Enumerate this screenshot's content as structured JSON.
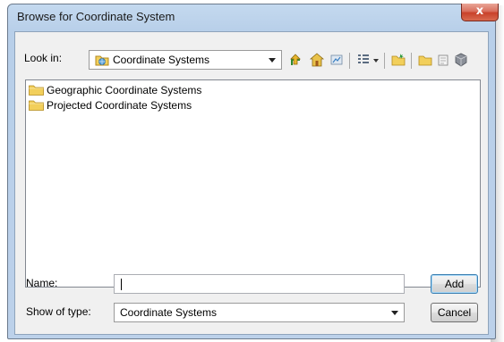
{
  "window": {
    "title": "Browse for Coordinate System",
    "close_label": "x"
  },
  "look_in": {
    "label": "Look in:",
    "value": "Coordinate Systems"
  },
  "toolbar": {
    "icons": [
      "up-one-level-icon",
      "home-icon",
      "connect-folder-icon",
      "view-options-icon",
      "view-dropdown-icon",
      "new-folder-icon",
      "folder-icon",
      "new-item-icon",
      "catalog-options-icon"
    ]
  },
  "file_list": {
    "items": [
      {
        "label": "Geographic Coordinate Systems",
        "icon": "folder-icon"
      },
      {
        "label": "Projected Coordinate Systems",
        "icon": "folder-icon"
      }
    ]
  },
  "name": {
    "label": "Name:",
    "value": ""
  },
  "show_of_type": {
    "label": "Show of type:",
    "value": "Coordinate Systems"
  },
  "buttons": {
    "add": "Add",
    "cancel": "Cancel"
  },
  "colors": {
    "title_bar": "#c4d9ef",
    "close_button": "#c9412a",
    "folder": "#f2cf5b",
    "default_button_border": "#3c7fb1"
  }
}
